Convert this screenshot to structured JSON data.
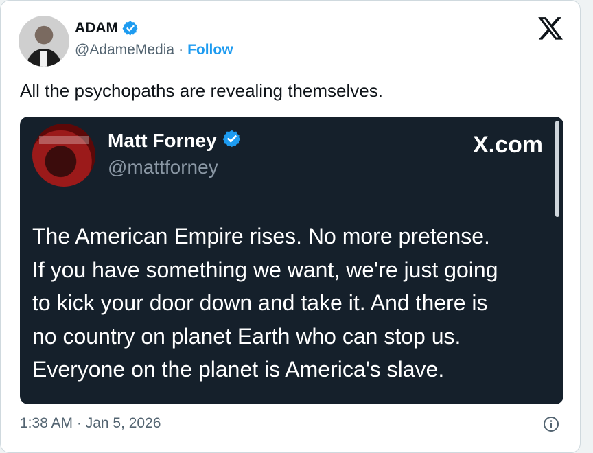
{
  "author": {
    "name": "ADAM",
    "handle": "@AdameMedia",
    "separator": "·",
    "follow_label": "Follow",
    "verified": true
  },
  "tweet": {
    "text": "All the psychopaths are revealing themselves."
  },
  "quoted": {
    "name": "Matt Forney",
    "handle": "@mattforney",
    "brand": "X.com",
    "verified": true,
    "lines": [
      "The American Empire rises. No more pretense.",
      "If you have something we want, we're just going",
      "to kick your door down and take it. And there is",
      "no country on planet Earth who can stop us.",
      "Everyone on the planet is America's slave."
    ]
  },
  "footer": {
    "timestamp": "1:38 AM · Jan 5, 2026"
  },
  "icons": {
    "verified": "verified-badge-icon",
    "logo": "x-logo-icon",
    "info": "info-icon"
  },
  "colors": {
    "accent": "#1d9bf0",
    "embed_bg": "#15202b",
    "muted": "#536471"
  }
}
